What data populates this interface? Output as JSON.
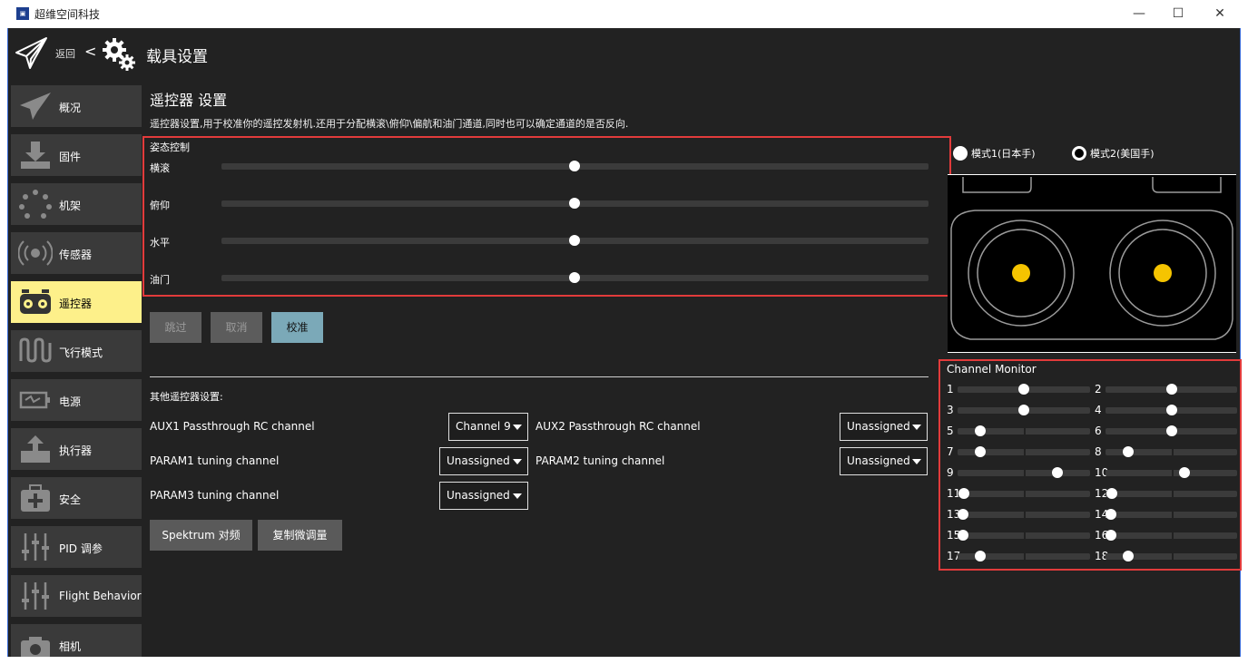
{
  "window": {
    "title": "超维空间科技",
    "minimize": "—",
    "maximize": "☐",
    "close": "✕"
  },
  "header": {
    "back_label": "返回",
    "separator": "<",
    "page_title": "载具设置"
  },
  "sidebar": {
    "items": [
      {
        "label": "概况",
        "icon": "plane-icon"
      },
      {
        "label": "固件",
        "icon": "download-icon"
      },
      {
        "label": "机架",
        "icon": "frame-dots-icon"
      },
      {
        "label": "传感器",
        "icon": "sensor-icon"
      },
      {
        "label": "遥控器",
        "icon": "remote-icon",
        "active": true
      },
      {
        "label": "飞行模式",
        "icon": "wave-icon"
      },
      {
        "label": "电源",
        "icon": "battery-icon"
      },
      {
        "label": "执行器",
        "icon": "actuator-icon"
      },
      {
        "label": "安全",
        "icon": "first-aid-icon"
      },
      {
        "label": "PID 调参",
        "icon": "sliders-icon"
      },
      {
        "label": "Flight Behavior",
        "icon": "sliders-icon"
      },
      {
        "label": "相机",
        "icon": "camera-icon"
      }
    ]
  },
  "main": {
    "heading": "遥控器 设置",
    "description": "遥控器设置,用于校准你的遥控发射机.还用于分配横滚\\俯仰\\偏航和油门通道,同时也可以确定通道的是否反向.",
    "attitude": {
      "title": "姿态控制",
      "channels": [
        {
          "label": "横滚",
          "value": 0.5
        },
        {
          "label": "俯仰",
          "value": 0.5
        },
        {
          "label": "水平",
          "value": 0.5
        },
        {
          "label": "油门",
          "value": 0.5
        }
      ]
    },
    "buttons": {
      "skip": "跳过",
      "cancel": "取消",
      "calibrate": "校准"
    },
    "other": {
      "title": "其他遥控器设置:",
      "aux1_label": "AUX1 Passthrough RC channel",
      "aux1_value": "Channel 9",
      "aux2_label": "AUX2 Passthrough RC channel",
      "aux2_value": "Unassigned",
      "param1_label": "PARAM1 tuning channel",
      "param1_value": "Unassigned",
      "param2_label": "PARAM2 tuning channel",
      "param2_value": "Unassigned",
      "param3_label": "PARAM3 tuning channel",
      "param3_value": "Unassigned",
      "spektrum_label": "Spektrum 对频",
      "copy_trims_label": "复制微调量"
    }
  },
  "right": {
    "mode1_label": "模式1(日本手)",
    "mode2_label": "模式2(美国手)",
    "selected_mode": 2,
    "stick_color": "#f5c400",
    "channel_monitor": {
      "title": "Channel Monitor",
      "channels": [
        {
          "n": "1",
          "value": 0.5
        },
        {
          "n": "2",
          "value": 0.5
        },
        {
          "n": "3",
          "value": 0.5
        },
        {
          "n": "4",
          "value": 0.5
        },
        {
          "n": "5",
          "value": 0.17
        },
        {
          "n": "6",
          "value": 0.5
        },
        {
          "n": "7",
          "value": 0.17
        },
        {
          "n": "8",
          "value": 0.17
        },
        {
          "n": "9",
          "value": 0.75
        },
        {
          "n": "10",
          "value": 0.6
        },
        {
          "n": "11",
          "value": 0.05
        },
        {
          "n": "12",
          "value": 0.05
        },
        {
          "n": "13",
          "value": 0.04
        },
        {
          "n": "14",
          "value": 0.04
        },
        {
          "n": "15",
          "value": 0.04
        },
        {
          "n": "16",
          "value": 0.04
        },
        {
          "n": "17",
          "value": 0.17
        },
        {
          "n": "18",
          "value": 0.17
        }
      ]
    }
  },
  "colors": {
    "accent_active": "#fdf08a",
    "calibrate_button": "#7ba9b8",
    "highlight_box": "#e23b3b"
  }
}
